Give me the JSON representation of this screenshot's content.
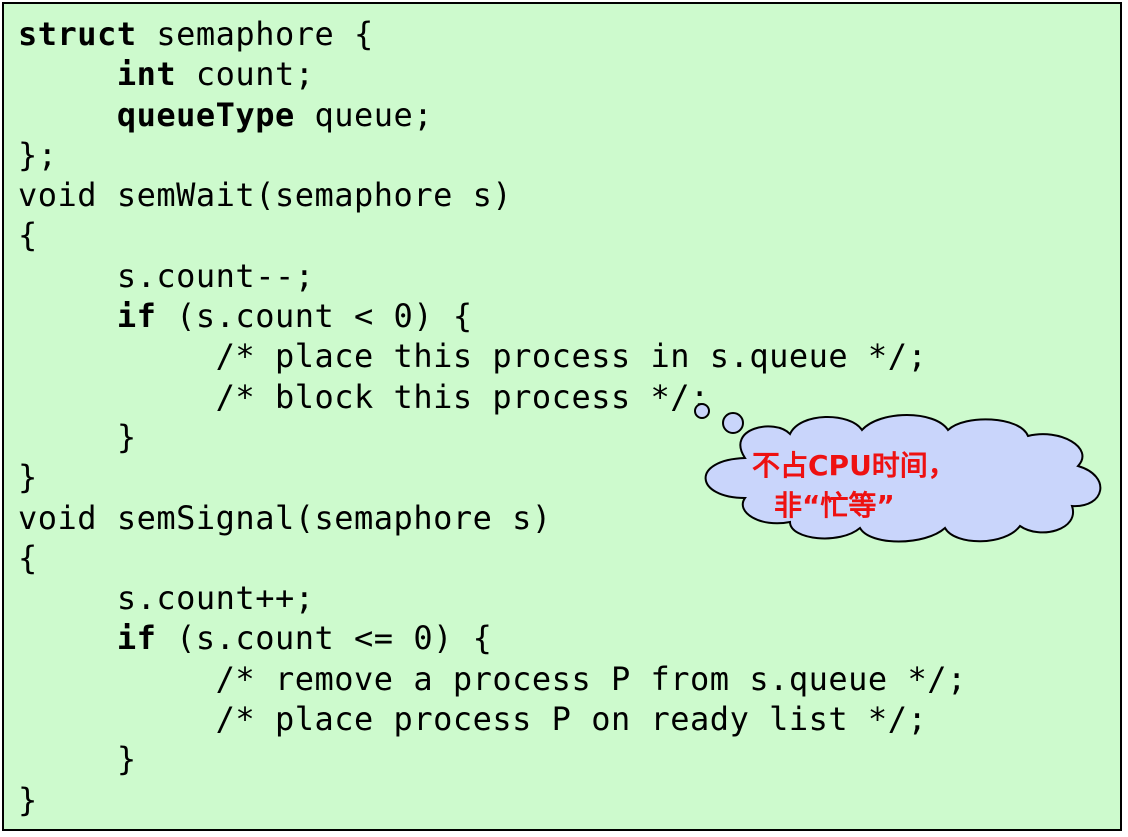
{
  "code": {
    "lines": [
      {
        "indent": "",
        "kw": "struct",
        "rest": " semaphore {"
      },
      {
        "indent": "     ",
        "kw": "int",
        "rest": " count;"
      },
      {
        "indent": "     ",
        "kw": "queueType",
        "rest": " queue;"
      },
      {
        "indent": "",
        "kw": "",
        "rest": "};"
      },
      {
        "indent": "",
        "kw": "",
        "rest": "void semWait(semaphore s)"
      },
      {
        "indent": "",
        "kw": "",
        "rest": "{"
      },
      {
        "indent": "     ",
        "kw": "",
        "rest": "s.count--;"
      },
      {
        "indent": "     ",
        "kw": "if",
        "rest": " (s.count < 0) {"
      },
      {
        "indent": "          ",
        "kw": "",
        "rest": "/* place this process in s.queue */;"
      },
      {
        "indent": "          ",
        "kw": "",
        "rest": "/* block this process */;"
      },
      {
        "indent": "     ",
        "kw": "",
        "rest": "}"
      },
      {
        "indent": "",
        "kw": "",
        "rest": "}"
      },
      {
        "indent": "",
        "kw": "",
        "rest": "void semSignal(semaphore s)"
      },
      {
        "indent": "",
        "kw": "",
        "rest": "{"
      },
      {
        "indent": "     ",
        "kw": "",
        "rest": "s.count++;"
      },
      {
        "indent": "     ",
        "kw": "if",
        "rest": " (s.count <= 0) {"
      },
      {
        "indent": "          ",
        "kw": "",
        "rest": "/* remove a process P from s.queue */;"
      },
      {
        "indent": "          ",
        "kw": "",
        "rest": "/* place process P on ready list */;"
      },
      {
        "indent": "     ",
        "kw": "",
        "rest": "}"
      },
      {
        "indent": "",
        "kw": "",
        "rest": "}"
      }
    ]
  },
  "callout": {
    "line1": "不占CPU时间，",
    "line2": "非“忙等”",
    "fill_color": "#c9d5fb",
    "text_color": "#ee1111"
  },
  "colors": {
    "background": "#cdfacd",
    "text": "#000000"
  }
}
